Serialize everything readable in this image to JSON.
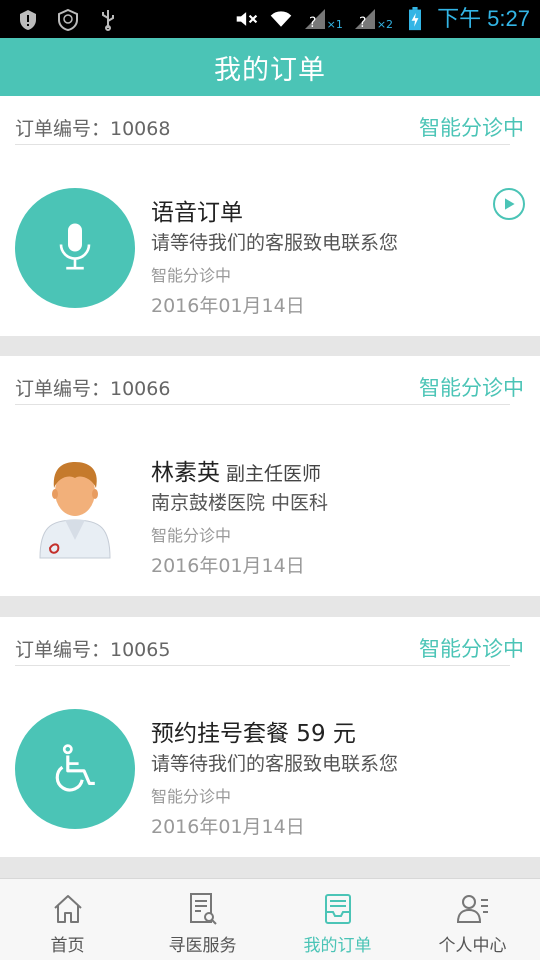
{
  "status_bar": {
    "time": "下午 5:27",
    "sim1_badge": "×1",
    "sim2_badge": "×2"
  },
  "header": {
    "title": "我的订单"
  },
  "orders": [
    {
      "order_no": "订单编号：10068",
      "status_top": "智能分诊中",
      "title": "语音订单",
      "title_sub": "",
      "desc": "请等待我们的客服致电联系您",
      "state": "智能分诊中",
      "date": "2016年01月14日",
      "avatar": "microphone-icon"
    },
    {
      "order_no": "订单编号：10066",
      "status_top": "智能分诊中",
      "title": "林素英",
      "title_sub": "副主任医师",
      "desc": "南京鼓楼医院  中医科",
      "state": "智能分诊中",
      "date": "2016年01月14日",
      "avatar": "doctor-avatar"
    },
    {
      "order_no": "订单编号：10065",
      "status_top": "智能分诊中",
      "title": "预约挂号套餐 59 元",
      "title_sub": "",
      "desc": "请等待我们的客服致电联系您",
      "state": "智能分诊中",
      "date": "2016年01月14日",
      "avatar": "wheelchair-icon"
    }
  ],
  "nav": {
    "items": [
      {
        "label": "首页",
        "icon": "home-icon"
      },
      {
        "label": "寻医服务",
        "icon": "search-doc-icon"
      },
      {
        "label": "我的订单",
        "icon": "orders-icon",
        "active": true
      },
      {
        "label": "个人中心",
        "icon": "profile-icon"
      }
    ]
  },
  "colors": {
    "accent": "#4bc4b6",
    "status_time": "#33b5e5"
  }
}
